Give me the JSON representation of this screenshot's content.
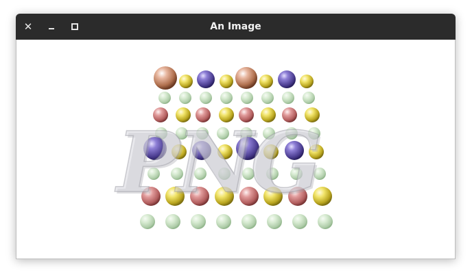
{
  "window": {
    "title": "An Image"
  },
  "controls": {
    "close_glyph": "✕"
  },
  "image": {
    "logo_text": "PNG"
  }
}
